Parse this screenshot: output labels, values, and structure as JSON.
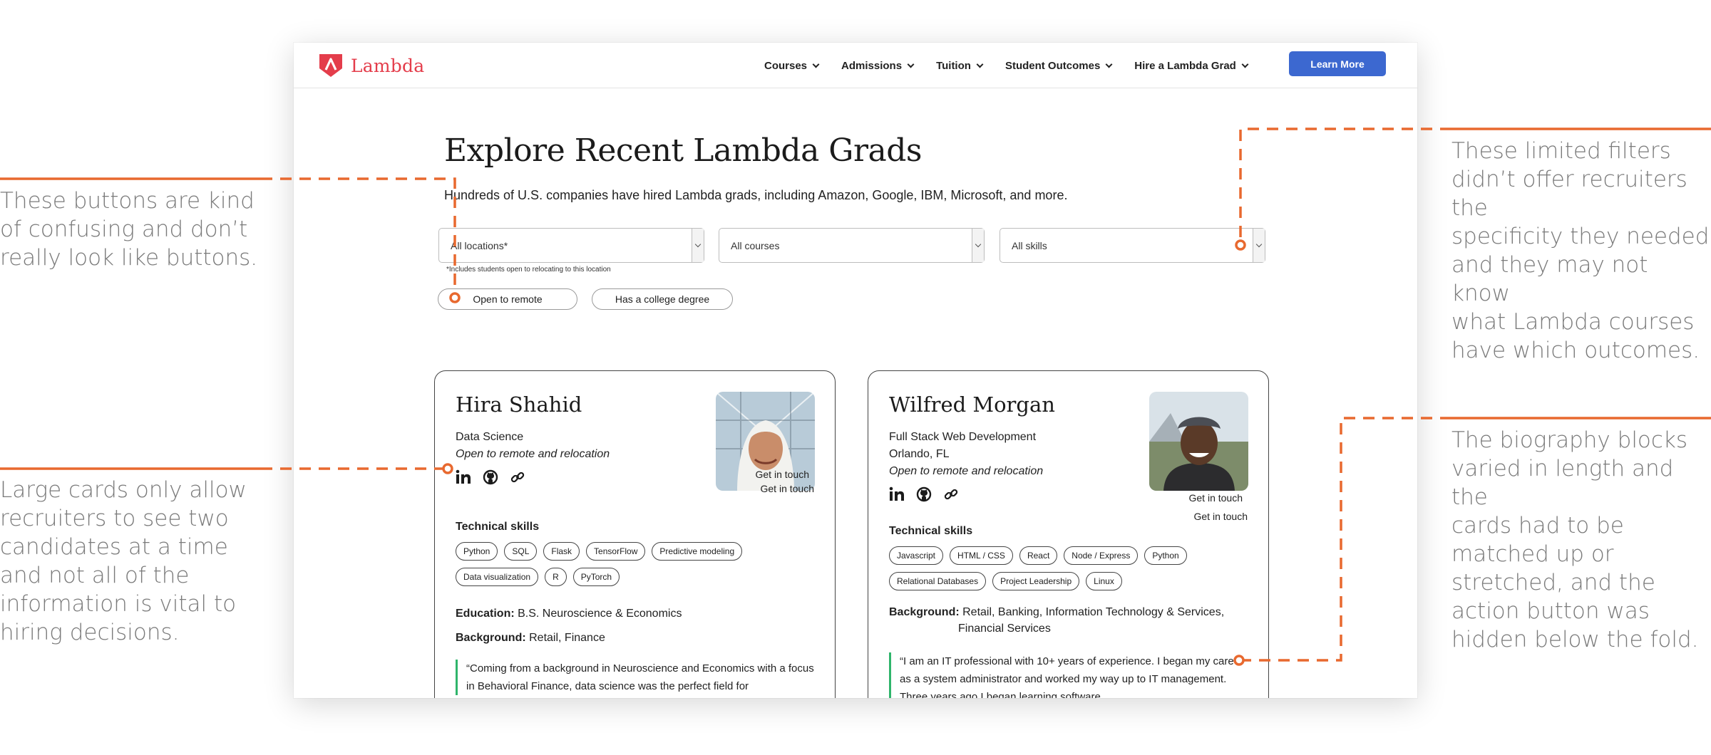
{
  "annotations": [
    {
      "text": "These buttons are kind\nof confusing and don’t\nreally look like buttons."
    },
    {
      "text": "Large cards only allow\nrecruiters to see two\ncandidates at a time\nand not all of the\ninformation is vital to\nhiring decisions."
    },
    {
      "text": "These limited filters\ndidn’t offer recruiters the\nspecificity they needed\nand they may not know\nwhat Lambda courses\nhave which outcomes."
    },
    {
      "text": "The biography blocks\nvaried in length and the\ncards had to be\nmatched up or\nstretched, and the\naction button was\nhidden below the fold."
    }
  ],
  "colors": {
    "annotation_line": "#e8692f",
    "brand": "#e43d4b",
    "primary_button": "#3c68d0",
    "quote_bar": "#2fb56b"
  },
  "nav": {
    "logo_text": "Lambda",
    "items": [
      "Courses",
      "Admissions",
      "Tuition",
      "Student Outcomes",
      "Hire a Lambda Grad"
    ],
    "cta": "Learn More"
  },
  "page": {
    "title": "Explore Recent Lambda Grads",
    "subtitle": "Hundreds of U.S. companies have hired Lambda grads, including Amazon, Google, IBM, Microsoft, and more."
  },
  "filters": {
    "location": "All locations*",
    "courses": "All courses",
    "skills": "All skills",
    "location_note": "*Includes students open to relocating to this location",
    "toggle_remote": "Open to remote",
    "toggle_degree": "Has a college degree"
  },
  "cards": [
    {
      "name": "Hira Shahid",
      "track": "Data Science",
      "location": "",
      "availability": "Open to remote and relocation",
      "get_in_touch_1": "Get in touch",
      "get_in_touch_2": "Get in touch",
      "skills_heading": "Technical skills",
      "skills": [
        "Python",
        "SQL",
        "Flask",
        "TensorFlow",
        "Predictive modeling",
        "Data visualization",
        "R",
        "PyTorch"
      ],
      "education_label": "Education:",
      "education": "B.S. Neuroscience & Economics",
      "background_label": "Background:",
      "background": "Retail, Finance",
      "quote": "“Coming from a background in Neuroscience and Economics with a focus in Behavioral Finance, data science was the perfect field for"
    },
    {
      "name": "Wilfred Morgan",
      "track": "Full Stack Web Development",
      "location": "Orlando, FL",
      "availability": "Open to remote and relocation",
      "get_in_touch_1": "Get in touch",
      "get_in_touch_2": "Get in touch",
      "skills_heading": "Technical skills",
      "skills": [
        "Javascript",
        "HTML / CSS",
        "React",
        "Node / Express",
        "Python",
        "Relational Databases",
        "Project Leadership",
        "Linux"
      ],
      "background_label": "Background:",
      "background": "Retail, Banking, Information Technology & Services,",
      "background_2": "Financial Services",
      "quote": "“I am an IT professional with 10+ years of experience. I began my career as a system administrator and worked my way up to IT management. Three years ago I began learning software"
    }
  ]
}
